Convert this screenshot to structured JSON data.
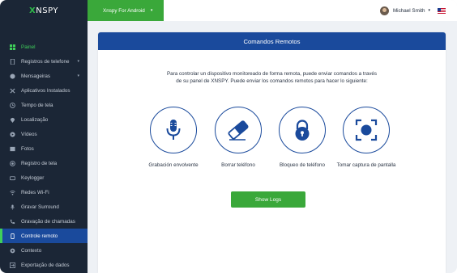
{
  "app": {
    "logo": {
      "x_letter": "X",
      "rest": "NSPY"
    },
    "colors": {
      "sidebar": "#1b2636",
      "accent_green": "#3aa83a",
      "primary_blue": "#1a4a9c"
    }
  },
  "topbar": {
    "device_label": "Xnspy For Android",
    "user_name": "Michael Smith",
    "flag_icon": "us-flag-icon"
  },
  "sidebar": {
    "items": [
      {
        "label": "Painel",
        "icon": "dashboard-icon",
        "caret": false
      },
      {
        "label": "Registros de telefone",
        "icon": "phone-icon",
        "caret": true
      },
      {
        "label": "Mensageiras",
        "icon": "message-icon",
        "caret": true
      },
      {
        "label": "Aplicativos Instalados",
        "icon": "tools-icon",
        "caret": false
      },
      {
        "label": "Tempo de tela",
        "icon": "clock-icon",
        "caret": false
      },
      {
        "label": "Localização",
        "icon": "location-icon",
        "caret": false
      },
      {
        "label": "Vídeos",
        "icon": "video-icon",
        "caret": false
      },
      {
        "label": "Fotos",
        "icon": "photo-icon",
        "caret": false
      },
      {
        "label": "Registro de tela",
        "icon": "screen-record-icon",
        "caret": false
      },
      {
        "label": "Keylogger",
        "icon": "keyboard-icon",
        "caret": false
      },
      {
        "label": "Redes Wi-Fi",
        "icon": "wifi-icon",
        "caret": false
      },
      {
        "label": "Gravar Surround",
        "icon": "mic-icon",
        "caret": false
      },
      {
        "label": "Gravação de chamadas",
        "icon": "call-record-icon",
        "caret": false
      },
      {
        "label": "Controle remoto",
        "icon": "remote-icon",
        "caret": false
      },
      {
        "label": "Contexto",
        "icon": "settings-icon",
        "caret": false
      },
      {
        "label": "Exportação de dados",
        "icon": "export-icon",
        "caret": false
      }
    ]
  },
  "main": {
    "title": "Comandos Remotos",
    "description_line1": "Para controlar un dispositivo monitoreado de forma remota, puede enviar comandos a través",
    "description_line2": "de su panel de XNSPY. Puede enviar los comandos remotos para hacer lo siguiente:",
    "commands": [
      {
        "label": "Grabación envolvente",
        "icon": "microphone-icon"
      },
      {
        "label": "Borrar teléfono",
        "icon": "eraser-icon"
      },
      {
        "label": "Bloqueo de teléfono",
        "icon": "lock-icon"
      },
      {
        "label": "Tomar captura de pantalla",
        "icon": "screenshot-icon"
      }
    ],
    "show_logs_label": "Show Logs"
  }
}
